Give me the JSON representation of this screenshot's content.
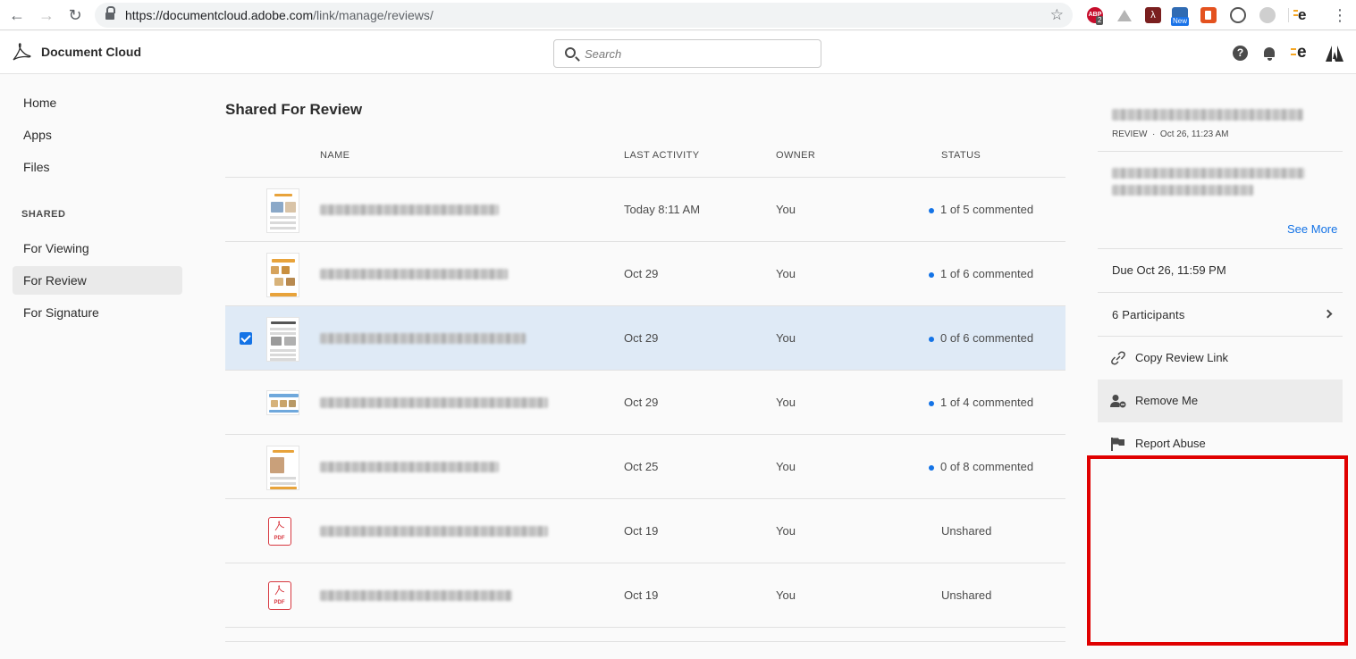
{
  "browser": {
    "url_host": "https://documentcloud.adobe.com",
    "url_path": "/link/manage/reviews/",
    "extensions": {
      "abp_badge": "2",
      "new_badge": "New"
    }
  },
  "header": {
    "app_title": "Document Cloud",
    "search_placeholder": "Search",
    "help_glyph": "?"
  },
  "sidebar": {
    "home": "Home",
    "apps": "Apps",
    "files": "Files",
    "shared_heading": "SHARED",
    "for_viewing": "For Viewing",
    "for_review": "For Review",
    "for_signature": "For Signature"
  },
  "main": {
    "title": "Shared For Review",
    "columns": {
      "name": "NAME",
      "last_activity": "LAST ACTIVITY",
      "owner": "OWNER",
      "status": "STATUS"
    },
    "rows": [
      {
        "last_activity": "Today 8:11 AM",
        "owner": "You",
        "status": "1 of 5 commented",
        "thumb": "doc-thumbnail"
      },
      {
        "last_activity": "Oct 29",
        "owner": "You",
        "status": "1 of 6 commented",
        "thumb": "doc-thumbnail"
      },
      {
        "last_activity": "Oct 29",
        "owner": "You",
        "status": "0 of 6 commented",
        "thumb": "doc-thumbnail",
        "selected": true
      },
      {
        "last_activity": "Oct 29",
        "owner": "You",
        "status": "1 of 4 commented",
        "thumb": "doc-thumbnail"
      },
      {
        "last_activity": "Oct 25",
        "owner": "You",
        "status": "0 of 8 commented",
        "thumb": "doc-thumbnail"
      },
      {
        "last_activity": "Oct 19",
        "owner": "You",
        "status": "Unshared",
        "thumb": "pdf-file-icon"
      },
      {
        "last_activity": "Oct 19",
        "owner": "You",
        "status": "Unshared",
        "thumb": "pdf-file-icon"
      }
    ],
    "pdf_label": "PDF"
  },
  "panel": {
    "meta_kind": "REVIEW",
    "meta_sep": "·",
    "meta_time": "Oct 26, 11:23 AM",
    "see_more": "See More",
    "due": "Due Oct 26, 11:59 PM",
    "participants": "6 Participants",
    "copy_link": "Copy Review Link",
    "remove_me": "Remove Me",
    "report_abuse": "Report Abuse"
  },
  "colors": {
    "accent": "#1473e6",
    "selected_row": "#dfeaf6",
    "highlight_box": "#e00000",
    "pdf_red": "#d7373f"
  }
}
